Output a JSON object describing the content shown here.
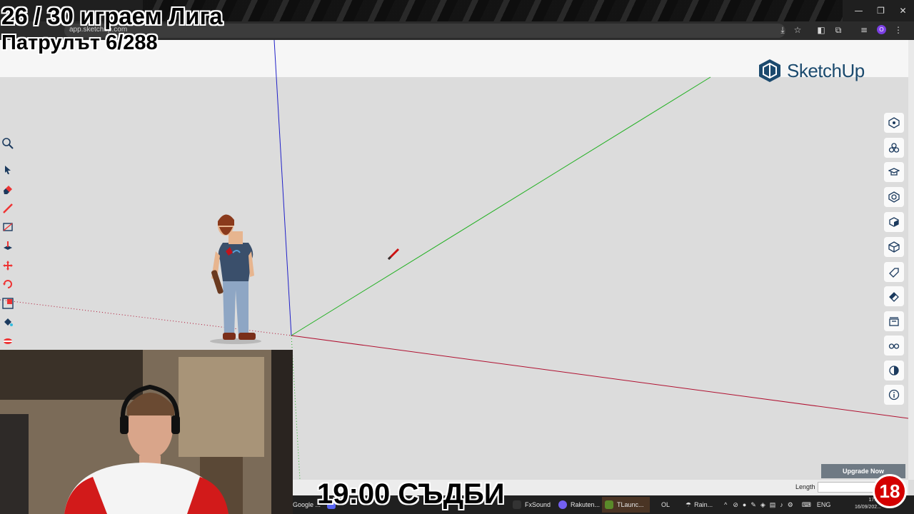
{
  "browser": {
    "url": "app.sketchup.com",
    "tab_label": "SketchUp",
    "window_controls": [
      "—",
      "❐",
      "✕"
    ]
  },
  "app": {
    "logo_text": "SketchUp",
    "upgrade_label": "Upgrade Now",
    "length_label": "Length",
    "length_value": ""
  },
  "left_tools": [
    {
      "name": "select-icon"
    },
    {
      "name": "eraser-icon"
    },
    {
      "name": "pencil-icon"
    },
    {
      "name": "rectangle-icon"
    },
    {
      "name": "push-pull-icon"
    },
    {
      "name": "move-icon"
    },
    {
      "name": "rotate-icon"
    },
    {
      "name": "scale-icon"
    },
    {
      "name": "paint-icon"
    },
    {
      "name": "tape-measure-icon"
    }
  ],
  "right_tools": [
    {
      "name": "entity-info-icon"
    },
    {
      "name": "components-icon"
    },
    {
      "name": "instructor-icon"
    },
    {
      "name": "materials-icon"
    },
    {
      "name": "outliner-icon"
    },
    {
      "name": "styles-icon"
    },
    {
      "name": "tags-icon"
    },
    {
      "name": "soften-icon"
    },
    {
      "name": "scenes-icon"
    },
    {
      "name": "display-icon"
    },
    {
      "name": "shadows-icon"
    },
    {
      "name": "info-icon"
    }
  ],
  "overlay": {
    "line1": "26 / 30 играем Лига",
    "line2": "Патрулът 6/288",
    "line3": "19:00 СЪДБИ",
    "badge": "18"
  },
  "taskbar": {
    "items": [
      "Google ...",
      "FxSound",
      "Rakuten...",
      "TLaunc..."
    ],
    "tray_left": "OL",
    "weather": "Rain...",
    "lang": "ENG",
    "time": "17:46",
    "date": "16/09/202..."
  },
  "colors": {
    "axis_blue": "#2020c8",
    "axis_green": "#22b022",
    "axis_red": "#b01030",
    "brand": "#1b4a6e"
  }
}
